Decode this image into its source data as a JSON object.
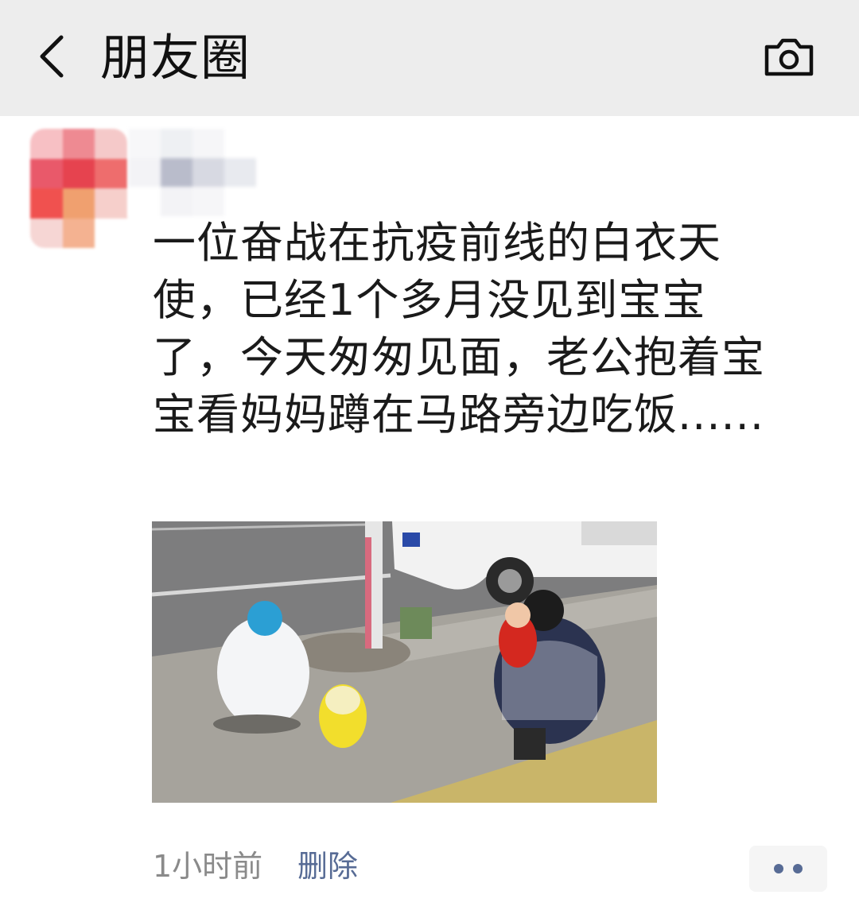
{
  "navbar": {
    "title": "朋友圈",
    "back_icon": "chevron-left-icon",
    "camera_icon": "camera-icon"
  },
  "post": {
    "text": "一位奋战在抗疫前线的白衣天使，已经1个多月没见到宝宝了，今天匆匆见面，老公抱着宝宝看妈妈蹲在马路旁边吃饭......",
    "time": "1小时前",
    "delete_label": "删除",
    "more_icon": "more-dots-icon"
  },
  "colors": {
    "navbar_bg": "#ededed",
    "link": "#576b95",
    "meta_text": "#8a8a8a"
  }
}
